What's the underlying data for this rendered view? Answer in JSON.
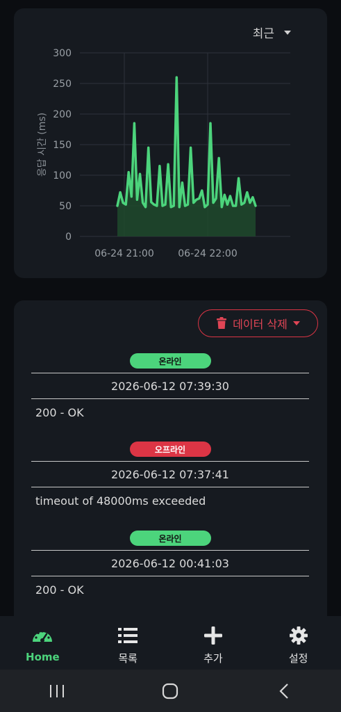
{
  "chart_card": {
    "period_select": "최근"
  },
  "chart_data": {
    "type": "area",
    "ylabel": "응답 시간 (ms)",
    "ylim": [
      0,
      300
    ],
    "yticks": [
      "300",
      "250",
      "200",
      "150",
      "100",
      "50",
      "0"
    ],
    "xticks": [
      "06-24 21:00",
      "06-24 22:00"
    ],
    "line_color": "#4cd47c",
    "fill_color": "#1f4a2d",
    "grid": true,
    "series": [
      {
        "values": [
          50,
          72,
          55,
          52,
          105,
          65,
          185,
          60,
          102,
          55,
          48,
          145,
          56,
          52,
          50,
          115,
          50,
          52,
          118,
          48,
          50,
          260,
          48,
          88,
          50,
          52,
          145,
          55,
          60,
          62,
          75,
          48,
          52,
          185,
          55,
          62,
          128,
          48,
          68,
          52,
          66,
          50,
          50,
          95,
          52,
          55,
          72,
          55,
          64,
          50
        ]
      }
    ]
  },
  "events_card": {
    "delete_button": "데이터 삭제",
    "events": [
      {
        "status": "온라인",
        "time": "2026-06-12 07:39:30",
        "message": "200 - OK"
      },
      {
        "status": "오프라인",
        "time": "2026-06-12 07:37:41",
        "message": "timeout of 48000ms exceeded"
      },
      {
        "status": "온라인",
        "time": "2026-06-12 00:41:03",
        "message": "200 - OK"
      }
    ]
  },
  "nav": {
    "home": "Home",
    "list": "목록",
    "add": "추가",
    "settings": "설정"
  },
  "colors": {
    "accent": "#4cd47c",
    "danger": "#dc3545",
    "card_bg": "#161a20",
    "page_bg": "#0b0d11"
  }
}
